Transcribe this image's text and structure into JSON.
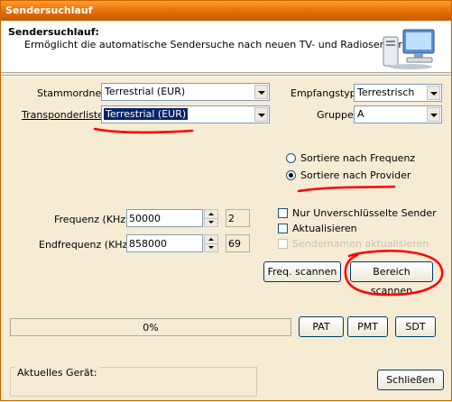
{
  "window": {
    "title": "Sendersuchlauf"
  },
  "header": {
    "title": "Sendersuchlauf:",
    "description": "Ermöglicht die automatische Sendersuche nach neuen TV- und Radiosendern."
  },
  "form": {
    "stammordner": {
      "label": "Stammordner",
      "value": "Terrestrial (EUR)"
    },
    "transponderliste": {
      "label": "Transponderliste",
      "value": "Terrestrial (EUR)"
    },
    "empfangstyp": {
      "label": "Empfangstyp",
      "value": "Terrestrisch"
    },
    "gruppe": {
      "label": "Gruppe",
      "value": "A"
    }
  },
  "sort": {
    "frequenz": "Sortiere nach Frequenz",
    "provider": "Sortiere nach Provider",
    "selected": "provider"
  },
  "frequency": {
    "start_label": "Frequenz (KHz)",
    "start_value": "50000",
    "start_step": "2",
    "end_label": "Endfrequenz (KHz)",
    "end_value": "858000",
    "end_step": "69"
  },
  "options": {
    "nur_unverschluesselt": {
      "label": "Nur Unverschlüsselte Sender",
      "checked": false
    },
    "aktualisieren": {
      "label": "Aktualisieren",
      "checked": false
    },
    "sendernamen": {
      "label": "Sendernamen aktualisieren",
      "checked": false,
      "enabled": false
    }
  },
  "buttons": {
    "freq_scan": "Freq. scannen",
    "bereich_scan": "Bereich scannen",
    "pat": "PAT",
    "pmt": "PMT",
    "sdt": "SDT",
    "close": "Schließen"
  },
  "progress": {
    "percent_text": "0%",
    "value": 0
  },
  "device": {
    "label": "Aktuelles Gerät:"
  },
  "colors": {
    "titlebar": "#e06a00",
    "background": "#f6ecd4",
    "annotation": "#ff0000"
  }
}
